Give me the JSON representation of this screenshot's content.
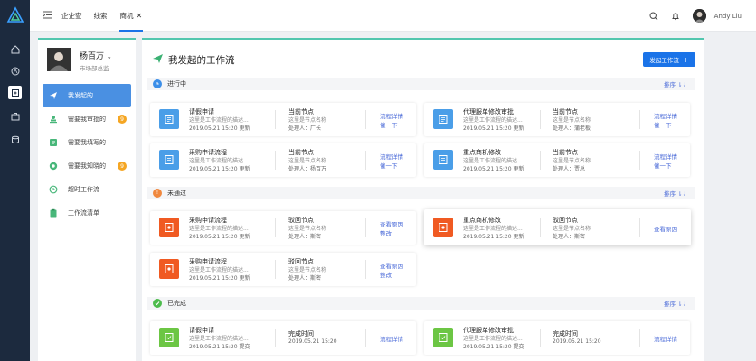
{
  "header": {
    "tabs": [
      "企企查",
      "线索",
      "商机"
    ],
    "username": "Andy Liu"
  },
  "user": {
    "name": "杨百万",
    "title": "市场部总监"
  },
  "sidebar": [
    {
      "label": "我发起的",
      "badge": ""
    },
    {
      "label": "需要我审批的",
      "badge": "9"
    },
    {
      "label": "需要我填写的",
      "badge": ""
    },
    {
      "label": "需要我知晓的",
      "badge": "9"
    },
    {
      "label": "超时工作流",
      "badge": ""
    },
    {
      "label": "工作流清单",
      "badge": ""
    }
  ],
  "main": {
    "title": "我发起的工作流",
    "start_button": "发起工作流",
    "sort_label": "排序",
    "sections": [
      "进行中",
      "未通过",
      "已完成"
    ]
  },
  "cards": [
    {
      "title": "请假申请",
      "desc": "这里是工作流程的描述...",
      "date": "2019.05.21  15:20",
      "date_suffix": "更新",
      "node_title": "当前节点",
      "node_sub": "这里是节点名称",
      "node_who": "处理人：厂长",
      "action1": "流程详情",
      "action2": "催一下"
    },
    {
      "title": "代理服单修改审批",
      "desc": "这里是工作流程的描述...",
      "date": "2019.05.21  15:20",
      "date_suffix": "更新",
      "node_title": "当前节点",
      "node_sub": "这里是节点名称",
      "node_who": "处理人：蒲老板",
      "action1": "流程详情",
      "action2": "催一下"
    },
    {
      "title": "采购申请流程",
      "desc": "这里是工作流程的描述...",
      "date": "2019.05.21  15:20",
      "date_suffix": "更新",
      "node_title": "当前节点",
      "node_sub": "这里是节点名称",
      "node_who": "处理人：杨百万",
      "action1": "流程详情",
      "action2": "催一下"
    },
    {
      "title": "重点商机修改",
      "desc": "这里是工作流程的描述...",
      "date": "2019.05.21  15:20",
      "date_suffix": "更新",
      "node_title": "当前节点",
      "node_sub": "这里是节点名称",
      "node_who": "处理人：贾总",
      "action1": "流程详情",
      "action2": "催一下"
    },
    {
      "title": "采购申请流程",
      "desc": "这里是工作流程的描述...",
      "date": "2019.05.21  15:20",
      "date_suffix": "更新",
      "node_title": "驳回节点",
      "node_sub": "这里是节点名称",
      "node_who": "处理人：斯密",
      "action1": "查看原因",
      "action2": "整改"
    },
    {
      "title": "重点商机修改",
      "desc": "这里是工作流程的描述...",
      "date": "2019.05.21  15:20",
      "date_suffix": "更新",
      "node_title": "驳回节点",
      "node_sub": "这里是节点名称",
      "node_who": "处理人：斯密",
      "action1": "查看原因",
      "action2": ""
    },
    {
      "title": "采购申请流程",
      "desc": "这里是工作流程的描述...",
      "date": "2019.05.21  15:20",
      "date_suffix": "更新",
      "node_title": "驳回节点",
      "node_sub": "这里是节点名称",
      "node_who": "处理人：斯密",
      "action1": "查看原因",
      "action2": "整改"
    },
    {
      "title": "请假申请",
      "desc": "这里是工作流程的描述...",
      "date": "2019.05.21  15:20",
      "date_suffix": "提交",
      "node_title": "完成时间",
      "node_sub": "2019.05.21  15:20",
      "node_who": "",
      "action1": "流程详情",
      "action2": ""
    },
    {
      "title": "代理服单修改审批",
      "desc": "这里是工作流程的描述...",
      "date": "2019.05.21  15:20",
      "date_suffix": "提交",
      "node_title": "完成时间",
      "node_sub": "2019.05.21  15:20",
      "node_who": "",
      "action1": "流程详情",
      "action2": ""
    }
  ],
  "colors": {
    "blue": "#4a9ee8",
    "orange": "#f05a22",
    "green": "#6cc644",
    "accent": "#1a73e8"
  }
}
